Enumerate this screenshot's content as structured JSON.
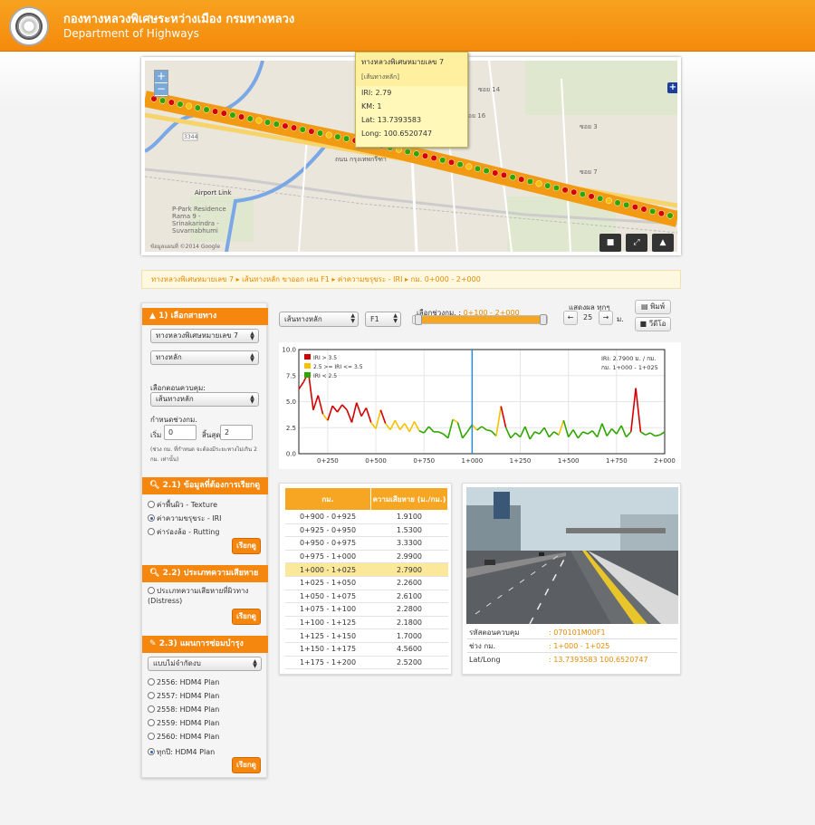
{
  "header": {
    "title_th": "กองทางหลวงพิเศษระหว่างเมือง กรมทางหลวง",
    "title_en": "Department of Highways"
  },
  "map": {
    "popup": {
      "title": "ทางหลวงพิเศษหมายเลข 7",
      "subtitle": "[เส้นทางหลัก]",
      "iri": "IRI: 2.79",
      "km": "KM: 1",
      "lat": "Lat: 13.7393583",
      "long": "Long: 100.6520747"
    },
    "labels": {
      "road_number": "3344",
      "place1": "P-Park Residence Rama 9 - Srinakarindra - Suvarnabhumi",
      "place2": "Airport Link",
      "copyright": "ข้อมูลแผนที่ ©2014 Google",
      "road_thai": "ถนน กรุงเทพกรีฑา",
      "soi1": "ซอย 14",
      "soi2": "ซอย 16",
      "soi3": "ซอย 3",
      "soi4": "ซอย 7"
    },
    "zoom_in": "+",
    "zoom_out": "−"
  },
  "breadcrumb": "ทางหลวงพิเศษหมายเลข 7  ▸  เส้นทางหลัก ขาออก เลน F1  ▸  ค่าความขรุขระ - IRI  ▸  กม. 0+000 - 2+000",
  "sidebar": {
    "section1": "1) เลือกสายทาง",
    "route_select": "ทางหลวงพิเศษหมายเลข 7",
    "route_type": "ทางหลัก",
    "control_label": "เลือกตอนควบคุม:",
    "control_select": "เส้นทางหลัก",
    "range_label": "กำหนดช่วงกม.",
    "start_label": "เริ่ม",
    "start_value": "0",
    "end_label": "สิ้นสุด",
    "end_value": "2",
    "note": "(ช่วง กม. ที่กำหนด จะต้องมีระยะทางไม่เกิน 2 กม. เท่านั้น)",
    "section2_1": "2.1) ข้อมูลที่ต้องการเรียกดู",
    "options2_1": [
      "ค่าพื้นผิว - Texture",
      "ค่าความขรุขระ - IRI",
      "ค่าร่องล้อ - Rutting"
    ],
    "view_button": "เรียกดู",
    "section2_2": "2.2) ประเภทความเสียหาย",
    "options2_2": [
      "ประเภทความเสียหายที่ผิวทาง (Distress)"
    ],
    "section2_3": "2.3) แผนการซ่อมบำรุง",
    "plan_select": "แบบไม่จำกัดงบ",
    "options2_3": [
      "2556: HDM4 Plan",
      "2557: HDM4 Plan",
      "2558: HDM4 Plan",
      "2559: HDM4 Plan",
      "2560: HDM4 Plan",
      "ทุกปี: HDM4 Plan"
    ]
  },
  "controls": {
    "lane_type": "เส้นทางหลัก",
    "lane": "F1",
    "range_label": "เลือกช่วงกม. :",
    "range_value": "0+100 - 2+000",
    "display_label": "แสดงผล ทุกๆ",
    "display_value": "25",
    "display_unit": "ม.",
    "print_button": "พิมพ์",
    "video_button": "วีดีโอ"
  },
  "chart_data": {
    "type": "line",
    "legend": [
      "IRI > 3.5",
      "2.5 >= IRI <= 3.5",
      "IRI < 2.5"
    ],
    "legend_colors": [
      "#d40000",
      "#f7c100",
      "#2fa600"
    ],
    "annotation_line1": "IRI: 2.7900 ม. / กม.",
    "annotation_line2": "กม. 1+000 - 1+025",
    "cursor_x": 1000,
    "xlim": [
      100,
      2000
    ],
    "ylim": [
      0,
      10
    ],
    "x_ticks": [
      250,
      500,
      750,
      1000,
      1250,
      1500,
      1750,
      2000
    ],
    "x_tick_labels": [
      "0+250",
      "0+500",
      "0+750",
      "1+000",
      "1+250",
      "1+500",
      "1+750",
      "2+000"
    ],
    "y_ticks": [
      0,
      2.5,
      5,
      7.5,
      10
    ],
    "y_tick_labels": [
      "0.0",
      "2.5",
      "5.0",
      "7.5",
      "10.0"
    ],
    "x": [
      100,
      125,
      150,
      175,
      200,
      225,
      250,
      275,
      300,
      325,
      350,
      375,
      400,
      425,
      450,
      475,
      500,
      525,
      550,
      575,
      600,
      625,
      650,
      675,
      700,
      725,
      750,
      775,
      800,
      825,
      850,
      875,
      900,
      925,
      950,
      975,
      1000,
      1025,
      1050,
      1075,
      1100,
      1125,
      1150,
      1175,
      1200,
      1225,
      1250,
      1275,
      1300,
      1325,
      1350,
      1375,
      1400,
      1425,
      1450,
      1475,
      1500,
      1525,
      1550,
      1575,
      1600,
      1625,
      1650,
      1675,
      1700,
      1725,
      1750,
      1775,
      1800,
      1825,
      1850,
      1875,
      1900,
      1925,
      1950,
      1975,
      2000
    ],
    "values": [
      6.2,
      6.9,
      7.8,
      4.2,
      5.6,
      3.8,
      3.2,
      4.6,
      4.0,
      4.7,
      4.2,
      3.0,
      4.9,
      3.6,
      4.4,
      3.0,
      2.4,
      4.2,
      2.9,
      2.3,
      3.2,
      2.3,
      2.9,
      2.1,
      3.1,
      2.2,
      2.0,
      2.6,
      2.1,
      2.1,
      1.9,
      1.5,
      3.3,
      3.0,
      1.5,
      2.1,
      2.79,
      2.26,
      2.61,
      2.28,
      2.18,
      1.7,
      4.56,
      2.52,
      1.5,
      2.0,
      1.6,
      2.6,
      1.4,
      2.1,
      1.9,
      2.5,
      1.6,
      2.1,
      1.8,
      3.2,
      1.6,
      2.3,
      1.5,
      2.1,
      1.9,
      2.2,
      1.6,
      2.9,
      1.7,
      2.4,
      1.9,
      2.7,
      1.6,
      2.1,
      6.3,
      2.1,
      1.8,
      2.0,
      1.7,
      1.8,
      2.1
    ]
  },
  "table": {
    "headers": [
      "กม.",
      "ความเสียหาย (ม./กม.)"
    ],
    "rows": [
      [
        "0+900 - 0+925",
        "1.9100"
      ],
      [
        "0+925 - 0+950",
        "1.5300"
      ],
      [
        "0+950 - 0+975",
        "3.3300"
      ],
      [
        "0+975 - 1+000",
        "2.9900"
      ],
      [
        "1+000 - 1+025",
        "2.7900"
      ],
      [
        "1+025 - 1+050",
        "2.2600"
      ],
      [
        "1+050 - 1+075",
        "2.6100"
      ],
      [
        "1+075 - 1+100",
        "2.2800"
      ],
      [
        "1+100 - 1+125",
        "2.1800"
      ],
      [
        "1+125 - 1+150",
        "1.7000"
      ],
      [
        "1+150 - 1+175",
        "4.5600"
      ],
      [
        "1+175 - 1+200",
        "2.5200"
      ]
    ],
    "highlight_index": 4
  },
  "photo_info": {
    "code_label": "รหัสตอนควบคุม",
    "code_value": ": 070101M00F1",
    "range_label": "ช่วง กม.",
    "range_value": ": 1+000 - 1+025",
    "latlong_label": "Lat/Long",
    "latlong_value": ": 13.7393583   100.6520747"
  }
}
